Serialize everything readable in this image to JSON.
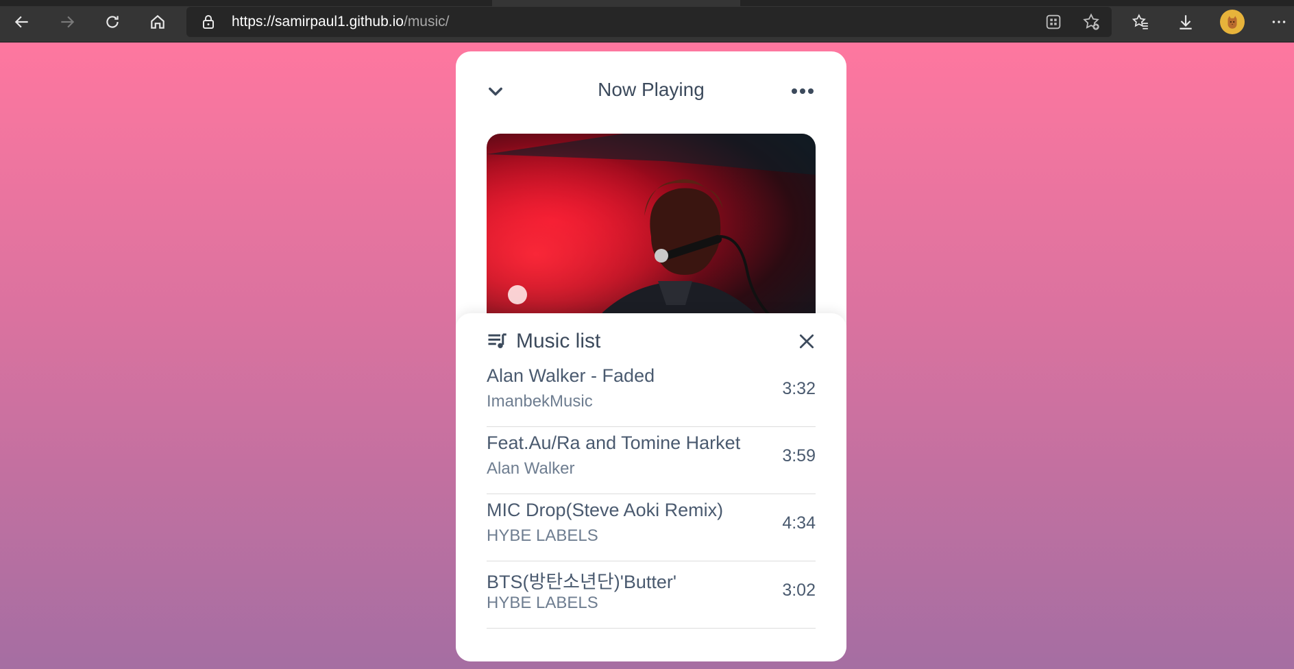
{
  "browser": {
    "url_host": "https://samirpaul1.github.io",
    "url_path": "/music/",
    "icons": [
      "back-arrow-icon",
      "forward-arrow-icon",
      "refresh-icon",
      "home-icon",
      "lock-icon",
      "apps-icon",
      "add-favorite-icon",
      "favorites-icon",
      "download-icon",
      "profile-avatar",
      "more-options-icon"
    ]
  },
  "player": {
    "header_title": "Now Playing",
    "collapse_icon": "chevron-down-icon",
    "menu_icon": "more-horizontal-icon"
  },
  "music_list": {
    "title": "Music list",
    "icon": "queue-music-icon",
    "close_icon": "close-icon",
    "songs": [
      {
        "title": "Alan Walker - Faded",
        "artist": "ImanbekMusic",
        "duration": "3:32"
      },
      {
        "title": "Feat.Au/Ra and Tomine Harket",
        "artist": "Alan Walker",
        "duration": "3:59"
      },
      {
        "title": "MIC Drop(Steve Aoki Remix)",
        "artist": "HYBE LABELS",
        "duration": "4:34"
      },
      {
        "title": "BTS(방탄소년단)'Butter'",
        "artist": "HYBE LABELS",
        "duration": "3:02"
      }
    ]
  },
  "colors": {
    "gradient_top": "#fe779f",
    "gradient_bottom": "#a56ea2",
    "text_primary": "#3c4a5c",
    "text_secondary": "#6e7d90"
  }
}
